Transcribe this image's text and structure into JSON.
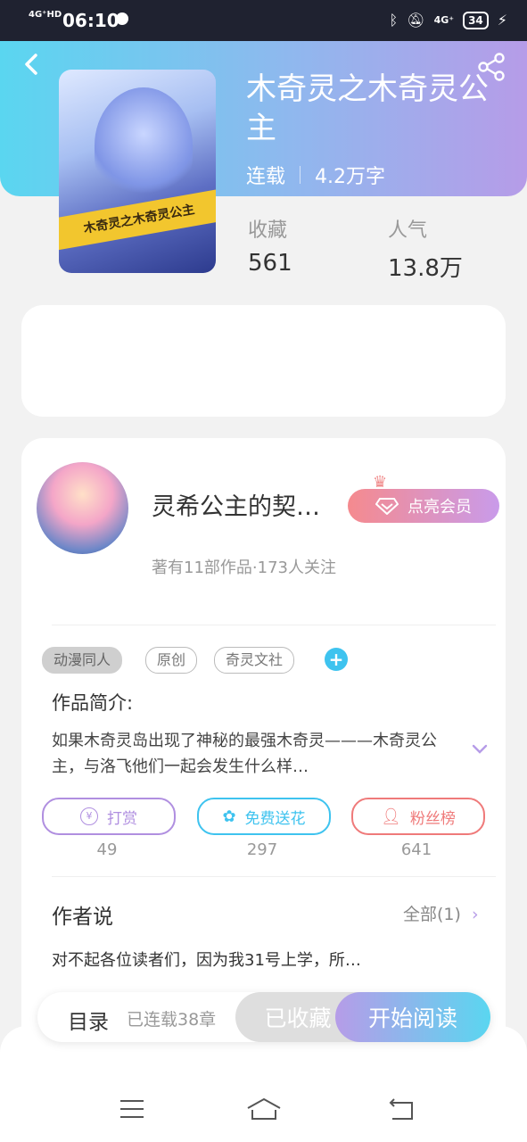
{
  "status_bar": {
    "signal": "4G⁺HD",
    "time": "06:10",
    "network": "4G⁺",
    "battery": "34"
  },
  "book": {
    "title": "木奇灵之木奇灵公主",
    "status": "连载",
    "word_count": "4.2万字",
    "cover_caption": "木奇灵之木奇灵公主",
    "stats": [
      {
        "label": "收藏",
        "value": "561"
      },
      {
        "label": "人气",
        "value": "13.8万"
      }
    ]
  },
  "author": {
    "name": "灵希公主的契…",
    "vip_label": "点亮会员",
    "meta": "著有11部作品·173人关注"
  },
  "tags": [
    "动漫同人",
    "原创",
    "奇灵文社"
  ],
  "intro": {
    "heading": "作品简介:",
    "text": "如果木奇灵岛出现了神秘的最强木奇灵———木奇灵公主，与洛飞他们一起会发生什么样…"
  },
  "actions": [
    {
      "label": "打赏",
      "count": "49",
      "color": "#b08fe0",
      "icon": "yen-icon"
    },
    {
      "label": "免费送花",
      "count": "297",
      "color": "#3ec3ef",
      "icon": "flower-icon"
    },
    {
      "label": "粉丝榜",
      "count": "641",
      "color": "#ef7a7a",
      "icon": "fans-icon"
    }
  ],
  "author_says": {
    "heading": "作者说",
    "all_label": "全部(1)",
    "text": "对不起各位读者们，因为我31号上学，所…"
  },
  "bottom_bar": {
    "toc_label": "目录",
    "serial_label": "已连载38章",
    "collected_label": "已收藏",
    "read_label": "开始阅读"
  }
}
